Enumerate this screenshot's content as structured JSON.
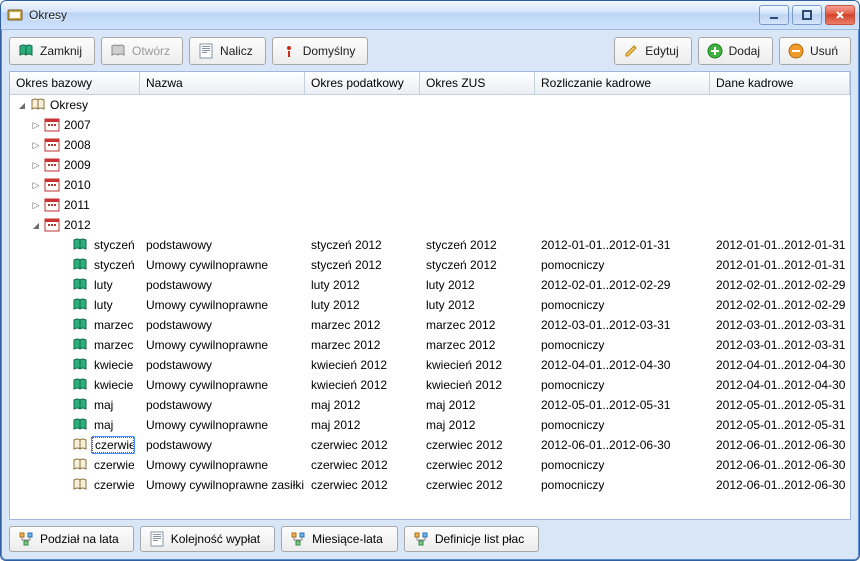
{
  "window": {
    "title": "Okresy"
  },
  "toolbar": {
    "left": [
      {
        "key": "close",
        "label": "Zamknij",
        "enabled": true,
        "icon": "book-green"
      },
      {
        "key": "open",
        "label": "Otwórz",
        "enabled": false,
        "icon": "book-gray"
      },
      {
        "key": "calc",
        "label": "Nalicz",
        "enabled": true,
        "icon": "form"
      },
      {
        "key": "default",
        "label": "Domyślny",
        "enabled": true,
        "icon": "bang-red"
      }
    ],
    "right": [
      {
        "key": "edit",
        "label": "Edytuj",
        "icon": "pencil"
      },
      {
        "key": "add",
        "label": "Dodaj",
        "icon": "plus-green"
      },
      {
        "key": "delete",
        "label": "Usuń",
        "icon": "minus-orange"
      }
    ]
  },
  "columns": [
    "Okres bazowy",
    "Nazwa",
    "Okres podatkowy",
    "Okres ZUS",
    "Rozliczanie kadrowe",
    "Dane kadrowe"
  ],
  "tree": {
    "root": {
      "label": "Okresy",
      "icon": "book-open"
    },
    "years": [
      {
        "label": "2007",
        "expanded": false
      },
      {
        "label": "2008",
        "expanded": false
      },
      {
        "label": "2009",
        "expanded": false
      },
      {
        "label": "2010",
        "expanded": false
      },
      {
        "label": "2011",
        "expanded": false
      },
      {
        "label": "2012",
        "expanded": true
      }
    ]
  },
  "rows": [
    {
      "okres": "styczeń",
      "nazwa": "podstawowy",
      "podatek": "styczeń 2012",
      "zus": "styczeń 2012",
      "rozl": "2012-01-01..2012-01-31",
      "dane": "2012-01-01..2012-01-31",
      "icon": "book-green"
    },
    {
      "okres": "styczeń",
      "nazwa": "Umowy cywilnoprawne",
      "podatek": "styczeń 2012",
      "zus": "styczeń 2012",
      "rozl": "pomocniczy",
      "dane": "2012-01-01..2012-01-31",
      "icon": "book-green"
    },
    {
      "okres": "luty",
      "nazwa": "podstawowy",
      "podatek": "luty 2012",
      "zus": "luty 2012",
      "rozl": "2012-02-01..2012-02-29",
      "dane": "2012-02-01..2012-02-29",
      "icon": "book-green"
    },
    {
      "okres": "luty",
      "nazwa": "Umowy cywilnoprawne",
      "podatek": "luty 2012",
      "zus": "luty 2012",
      "rozl": "pomocniczy",
      "dane": "2012-02-01..2012-02-29",
      "icon": "book-green"
    },
    {
      "okres": "marzec",
      "nazwa": "podstawowy",
      "podatek": "marzec 2012",
      "zus": "marzec 2012",
      "rozl": "2012-03-01..2012-03-31",
      "dane": "2012-03-01..2012-03-31",
      "icon": "book-green"
    },
    {
      "okres": "marzec",
      "nazwa": "Umowy cywilnoprawne",
      "podatek": "marzec 2012",
      "zus": "marzec 2012",
      "rozl": "pomocniczy",
      "dane": "2012-03-01..2012-03-31",
      "icon": "book-green"
    },
    {
      "okres": "kwiecień",
      "nazwa": "podstawowy",
      "podatek": "kwiecień 2012",
      "zus": "kwiecień 2012",
      "rozl": "2012-04-01..2012-04-30",
      "dane": "2012-04-01..2012-04-30",
      "icon": "book-green"
    },
    {
      "okres": "kwiecień",
      "nazwa": "Umowy cywilnoprawne",
      "podatek": "kwiecień 2012",
      "zus": "kwiecień 2012",
      "rozl": "pomocniczy",
      "dane": "2012-04-01..2012-04-30",
      "icon": "book-green"
    },
    {
      "okres": "maj",
      "nazwa": "podstawowy",
      "podatek": "maj 2012",
      "zus": "maj 2012",
      "rozl": "2012-05-01..2012-05-31",
      "dane": "2012-05-01..2012-05-31",
      "icon": "book-green"
    },
    {
      "okres": "maj",
      "nazwa": "Umowy cywilnoprawne",
      "podatek": "maj 2012",
      "zus": "maj 2012",
      "rozl": "pomocniczy",
      "dane": "2012-05-01..2012-05-31",
      "icon": "book-green"
    },
    {
      "okres": "czerwiec",
      "nazwa": "podstawowy",
      "podatek": "czerwiec 2012",
      "zus": "czerwiec 2012",
      "rozl": "2012-06-01..2012-06-30",
      "dane": "2012-06-01..2012-06-30",
      "icon": "book-open",
      "selected": true
    },
    {
      "okres": "czerwiec",
      "nazwa": "Umowy cywilnoprawne",
      "podatek": "czerwiec 2012",
      "zus": "czerwiec 2012",
      "rozl": "pomocniczy",
      "dane": "2012-06-01..2012-06-30",
      "icon": "book-open"
    },
    {
      "okres": "czerwiec",
      "nazwa": "Umowy cywilnoprawne zasiłki",
      "podatek": "czerwiec 2012",
      "zus": "czerwiec 2012",
      "rozl": "pomocniczy",
      "dane": "2012-06-01..2012-06-30",
      "icon": "book-open"
    }
  ],
  "tabs": [
    {
      "key": "years",
      "label": "Podział na lata",
      "icon": "hier"
    },
    {
      "key": "order",
      "label": "Kolejność wypłat",
      "icon": "form"
    },
    {
      "key": "months",
      "label": "Miesiące-lata",
      "icon": "hier"
    },
    {
      "key": "payroll",
      "label": "Definicje list płac",
      "icon": "hier"
    }
  ]
}
